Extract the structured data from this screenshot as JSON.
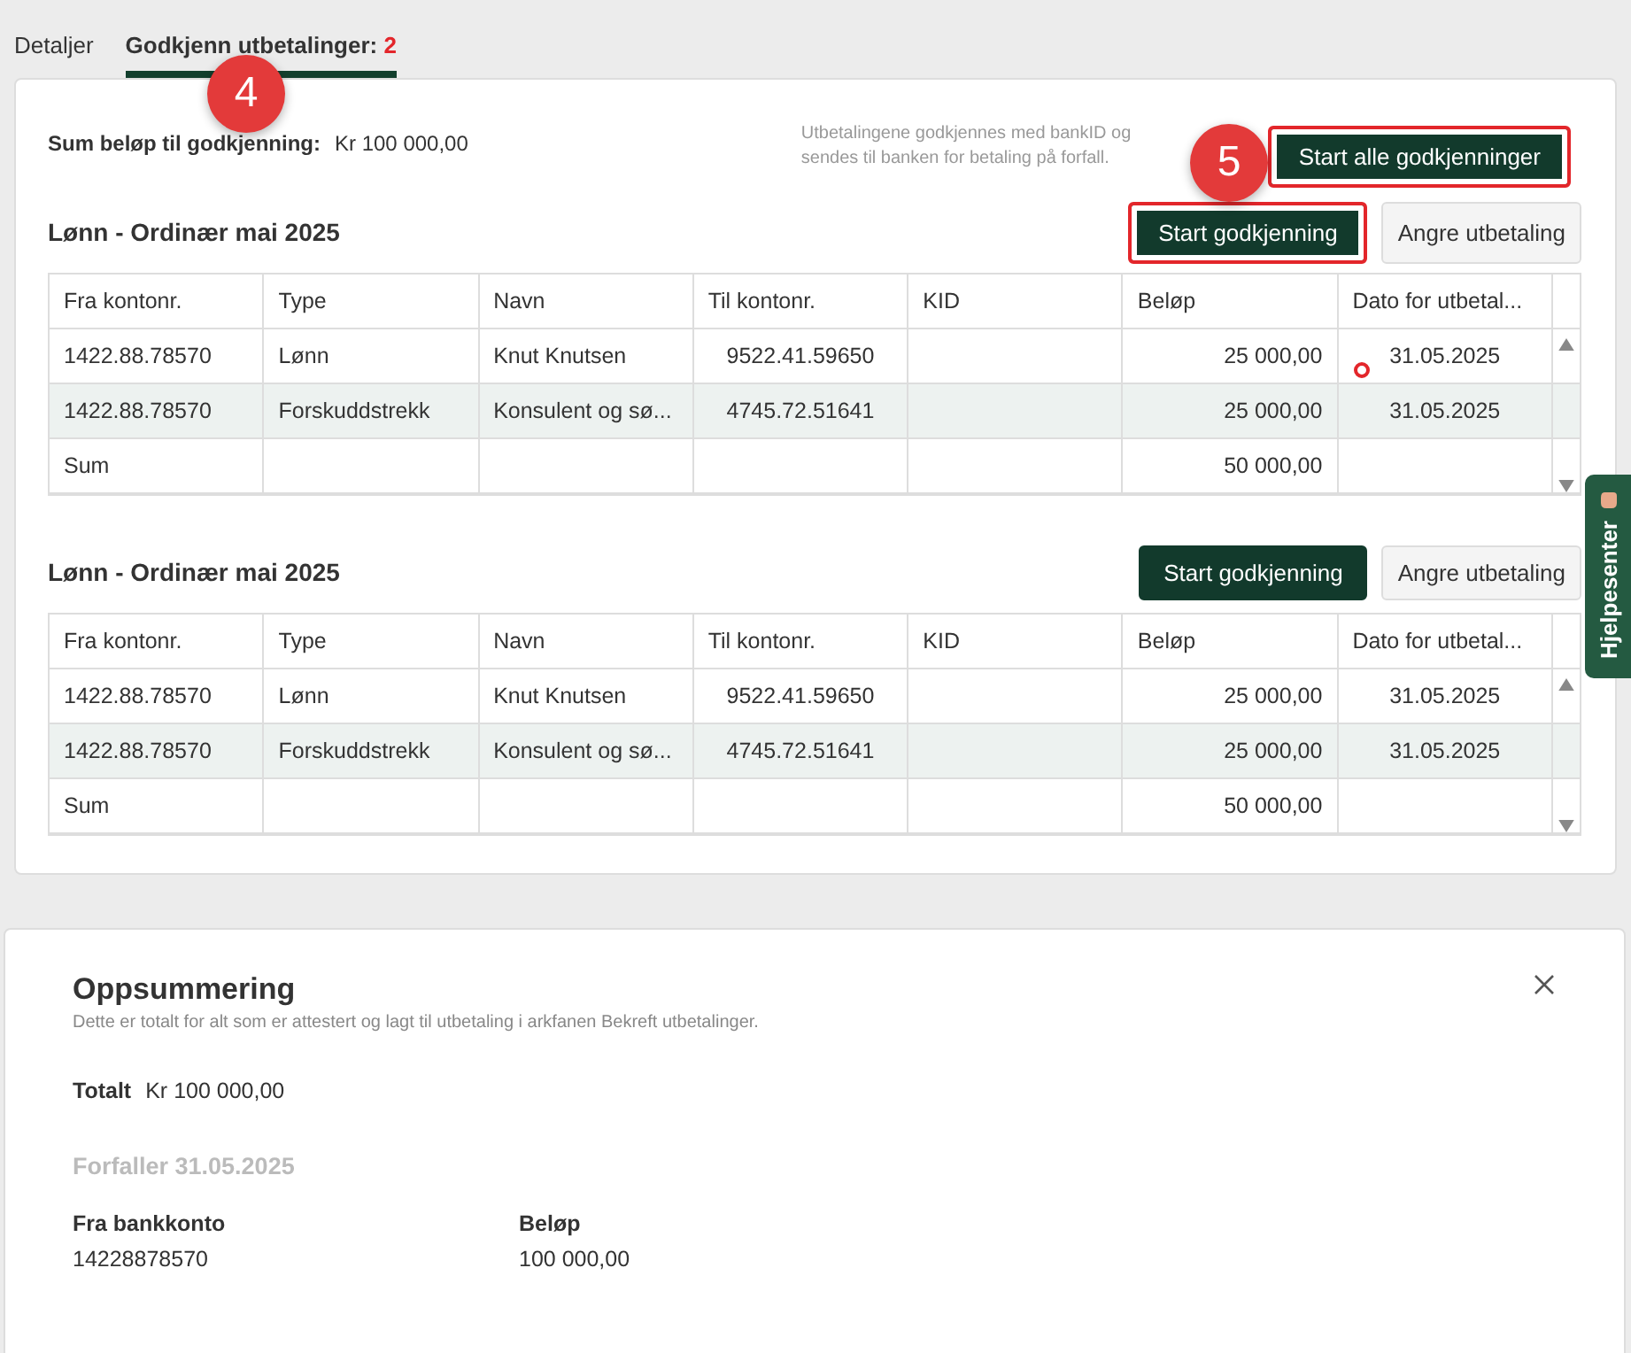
{
  "tabs": [
    {
      "label": "Detaljer",
      "selected": false
    },
    {
      "label": "Godkjenn utbetalinger:",
      "count": "2",
      "selected": true
    }
  ],
  "header": {
    "sum_label": "Sum beløp til godkjenning:",
    "sum_value": "Kr 100 000,00",
    "info": "Utbetalingene godkjennes med bankID og sendes til banken for betaling på forfall.",
    "start_all_button": {
      "label": "Start alle godkjenninger",
      "highlighted": true
    }
  },
  "groups": [
    {
      "title": "Lønn - Ordinær mai 2025",
      "start_button": {
        "label": "Start godkjenning",
        "highlighted": true
      },
      "undo_button": "Angre utbetaling",
      "columns": [
        "Fra kontonr.",
        "Type",
        "Navn",
        "Til kontonr.",
        "KID",
        "Beløp",
        "Dato for utbetal..."
      ],
      "rows": [
        [
          "1422.88.78570",
          "Lønn",
          "Knut Knutsen",
          "9522.41.59650",
          "",
          "25 000,00",
          "31.05.2025"
        ],
        [
          "1422.88.78570",
          "Forskuddstrekk",
          "Konsulent og sø...",
          "4745.72.51641",
          "",
          "25 000,00",
          "31.05.2025"
        ]
      ],
      "sum_row": {
        "label": "Sum",
        "amount": "50 000,00"
      }
    },
    {
      "title": "Lønn - Ordinær mai 2025",
      "start_button": {
        "label": "Start godkjenning",
        "highlighted": false
      },
      "undo_button": "Angre utbetaling",
      "columns": [
        "Fra kontonr.",
        "Type",
        "Navn",
        "Til kontonr.",
        "KID",
        "Beløp",
        "Dato for utbetal..."
      ],
      "rows": [
        [
          "1422.88.78570",
          "Lønn",
          "Knut Knutsen",
          "9522.41.59650",
          "",
          "25 000,00",
          "31.05.2025"
        ],
        [
          "1422.88.78570",
          "Forskuddstrekk",
          "Konsulent og sø...",
          "4745.72.51641",
          "",
          "25 000,00",
          "31.05.2025"
        ]
      ],
      "sum_row": {
        "label": "Sum",
        "amount": "50 000,00"
      }
    }
  ],
  "help_tab": "Hjelpesenter",
  "summary": {
    "title": "Oppsummering",
    "subtitle": "Dette er totalt for alt som er attestert og lagt til utbetaling i arkfanen Bekreft utbetalinger.",
    "total_label": "Totalt",
    "total_value": "Kr 100 000,00",
    "due_heading": "Forfaller 31.05.2025",
    "columns": [
      "Fra bankkonto",
      "Beløp"
    ],
    "values": [
      "14228878570",
      "100 000,00"
    ]
  },
  "annotations": [
    "4",
    "5"
  ]
}
